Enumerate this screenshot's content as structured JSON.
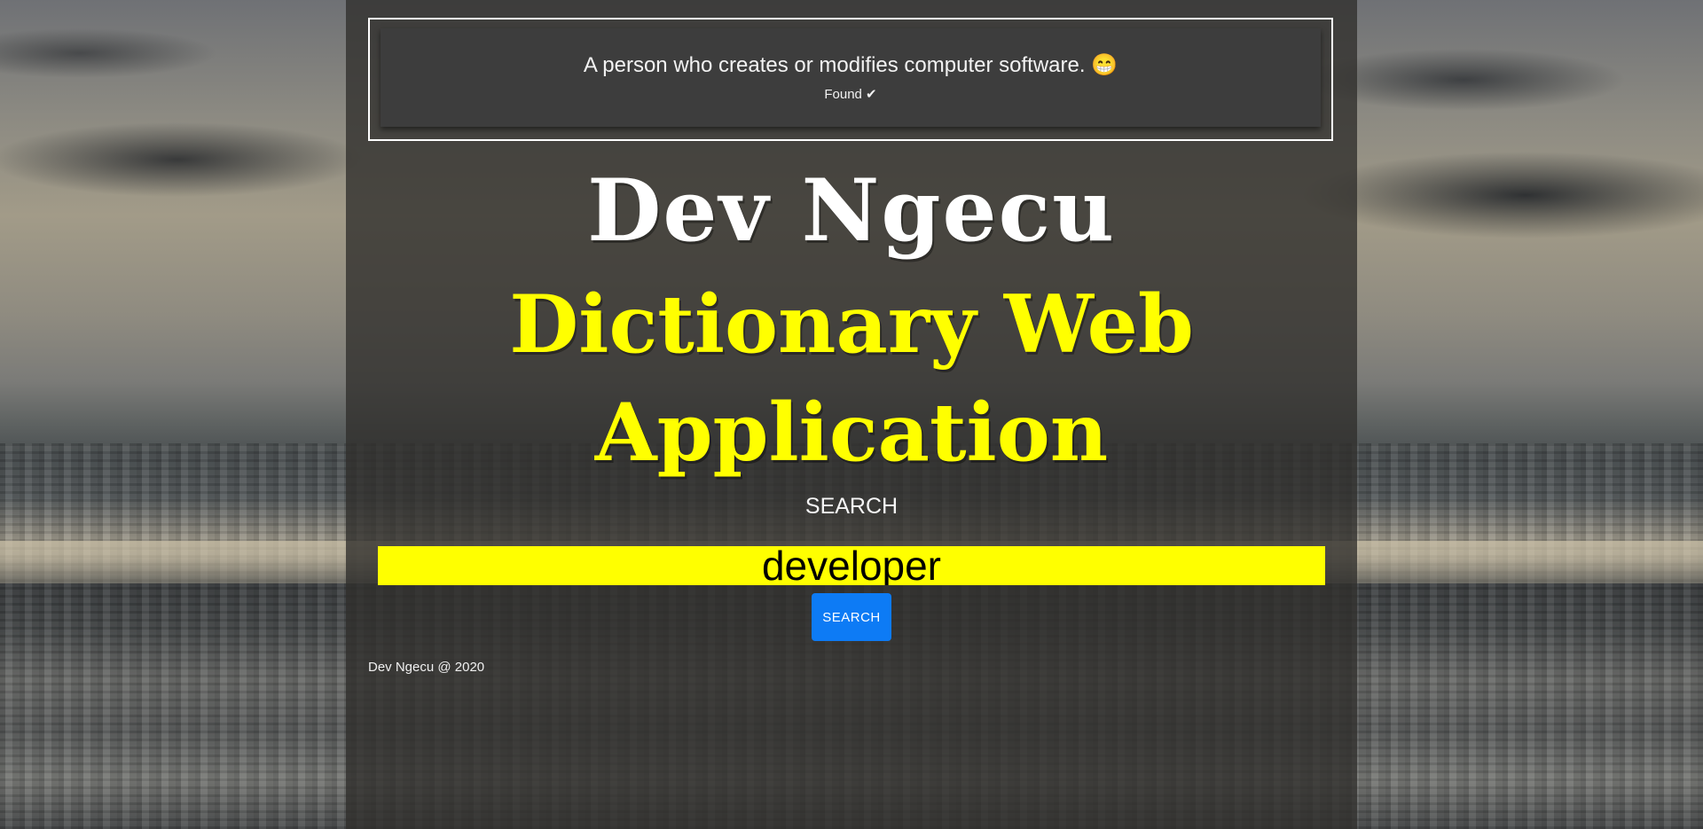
{
  "alert": {
    "definition": "A person who creates or modifies computer software. 😁",
    "status": "Found ✔"
  },
  "header": {
    "brand": "Dev Ngecu",
    "title_line1": "Dictionary Web",
    "title_line2": "Application"
  },
  "search": {
    "label": "SEARCH",
    "value": "developer",
    "button_label": "SEARCH"
  },
  "footer": {
    "text": "Dev Ngecu @ 2020"
  },
  "colors": {
    "accent_yellow": "#ffff00",
    "button_blue": "#0d7bf5",
    "panel_dark": "#302e2c"
  }
}
